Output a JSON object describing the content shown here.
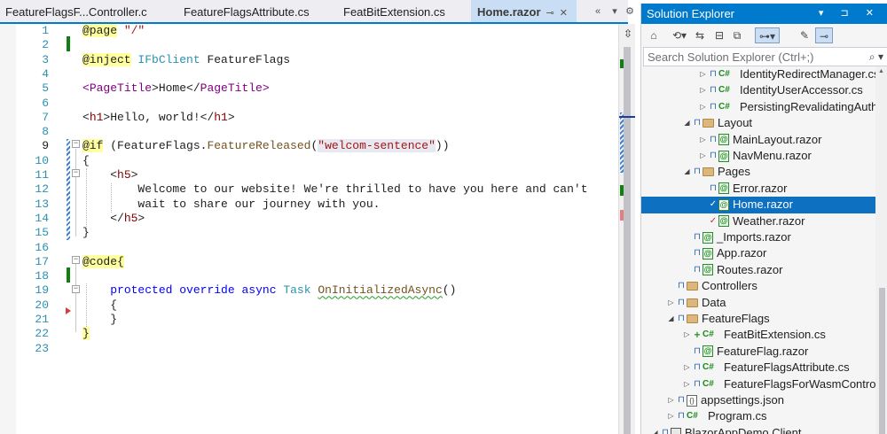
{
  "tabs": [
    {
      "title": "FeatureFlagsF...Controller.cs",
      "active": false
    },
    {
      "title": "FeatureFlagsAttribute.cs",
      "active": false
    },
    {
      "title": "FeatBitExtension.cs",
      "active": false
    },
    {
      "title": "Home.razor",
      "active": true
    }
  ],
  "tab_controls": {
    "pin_icon": "pin-icon",
    "close_icon": "close-icon",
    "scroll_left": "«",
    "dropdown": "▾",
    "settings": "⚙"
  },
  "editor": {
    "split_icon": "split-icon",
    "lines": [
      {
        "n": "1"
      },
      {
        "n": "2"
      },
      {
        "n": "3"
      },
      {
        "n": "4"
      },
      {
        "n": "5"
      },
      {
        "n": "6"
      },
      {
        "n": "7"
      },
      {
        "n": "8"
      },
      {
        "n": "9"
      },
      {
        "n": "10"
      },
      {
        "n": "11"
      },
      {
        "n": "12"
      },
      {
        "n": "13"
      },
      {
        "n": "14"
      },
      {
        "n": "15"
      },
      {
        "n": "16"
      },
      {
        "n": "17"
      },
      {
        "n": "18"
      },
      {
        "n": "19"
      },
      {
        "n": "20"
      },
      {
        "n": "21"
      },
      {
        "n": "22"
      },
      {
        "n": "23"
      }
    ],
    "code": {
      "l1_a": "@page",
      "l1_b": " ",
      "l1_c": "\"/\"",
      "l3_a": "@inject",
      "l3_b": " ",
      "l3_c": "IFbClient",
      "l3_d": " FeatureFlags",
      "l5_a": "<",
      "l5_b": "PageTitle",
      "l5_c": ">Home</",
      "l5_d": "PageTitle",
      "l5_e": ">",
      "l7_a": "<",
      "l7_b": "h1",
      "l7_c": ">Hello, world!</",
      "l7_d": "h1",
      "l7_e": ">",
      "l9_a": "@if",
      "l9_b": " (FeatureFlags.",
      "l9_c": "FeatureReleased",
      "l9_d": "(",
      "l9_e": "\"welcom-sentence\"",
      "l9_f": "))",
      "l10": "{",
      "l11_a": "    <",
      "l11_b": "h5",
      "l11_c": ">",
      "l12": "        Welcome to our website! We're thrilled to have you here and can't",
      "l13": "        wait to share our journey with you.",
      "l14_a": "    </",
      "l14_b": "h5",
      "l14_c": ">",
      "l15": "}",
      "l17_a": "@code",
      "l17_b": "{",
      "l19_a": "    ",
      "l19_b": "protected",
      "l19_c": " ",
      "l19_d": "override",
      "l19_e": " ",
      "l19_f": "async",
      "l19_g": " ",
      "l19_h": "Task",
      "l19_i": " ",
      "l19_j": "OnInitializedAsync",
      "l19_k": "()",
      "l20": "    {",
      "l21": "    }",
      "l22": "}"
    }
  },
  "solution_explorer": {
    "title": "Solution Explorer",
    "title_buttons": "▾ ⊐ ✕",
    "search_placeholder": "Search Solution Explorer (Ctrl+;)",
    "search_icon": "search-icon",
    "nodes": [
      {
        "label": "IdentityRedirectManager.cs",
        "kind": "cs",
        "expander": "▷",
        "status": "lock",
        "depth": 4
      },
      {
        "label": "IdentityUserAccessor.cs",
        "kind": "cs",
        "expander": "▷",
        "status": "lock",
        "depth": 4
      },
      {
        "label": "PersistingRevalidatingAuther",
        "kind": "cs",
        "expander": "▷",
        "status": "lock",
        "depth": 4
      },
      {
        "label": "Layout",
        "kind": "folder",
        "expander": "◢",
        "status": "lock",
        "depth": 3
      },
      {
        "label": "MainLayout.razor",
        "kind": "razor",
        "expander": "▷",
        "status": "lock",
        "depth": 4
      },
      {
        "label": "NavMenu.razor",
        "kind": "razor",
        "expander": "▷",
        "status": "lock",
        "depth": 4
      },
      {
        "label": "Pages",
        "kind": "folder",
        "expander": "◢",
        "status": "lock",
        "depth": 3
      },
      {
        "label": "Error.razor",
        "kind": "razor",
        "expander": "",
        "status": "lock",
        "depth": 4
      },
      {
        "label": "Home.razor",
        "kind": "razor",
        "expander": "",
        "status": "check",
        "depth": 4,
        "selected": true
      },
      {
        "label": "Weather.razor",
        "kind": "razor",
        "expander": "",
        "status": "check",
        "depth": 4
      },
      {
        "label": "_Imports.razor",
        "kind": "razor",
        "expander": "",
        "status": "lock",
        "depth": 3
      },
      {
        "label": "App.razor",
        "kind": "razor",
        "expander": "",
        "status": "lock",
        "depth": 3
      },
      {
        "label": "Routes.razor",
        "kind": "razor",
        "expander": "",
        "status": "lock",
        "depth": 3
      },
      {
        "label": "Controllers",
        "kind": "folder",
        "expander": "",
        "status": "lock",
        "depth": 2
      },
      {
        "label": "Data",
        "kind": "folder",
        "expander": "▷",
        "status": "lock",
        "depth": 2
      },
      {
        "label": "FeatureFlags",
        "kind": "folder",
        "expander": "◢",
        "status": "lock",
        "depth": 2
      },
      {
        "label": "FeatBitExtension.cs",
        "kind": "cs",
        "expander": "▷",
        "status": "add",
        "depth": 3
      },
      {
        "label": "FeatureFlag.razor",
        "kind": "razor",
        "expander": "",
        "status": "lock",
        "depth": 3
      },
      {
        "label": "FeatureFlagsAttribute.cs",
        "kind": "cs",
        "expander": "▷",
        "status": "lock",
        "depth": 3
      },
      {
        "label": "FeatureFlagsForWasmController",
        "kind": "cs",
        "expander": "▷",
        "status": "lock",
        "depth": 3
      },
      {
        "label": "appsettings.json",
        "kind": "json",
        "expander": "▷",
        "status": "lock",
        "depth": 2
      },
      {
        "label": "Program.cs",
        "kind": "cs",
        "expander": "▷",
        "status": "lock",
        "depth": 2
      },
      {
        "label": "BlazorAppDemo.Client",
        "kind": "proj",
        "expander": "◢",
        "status": "lock",
        "depth": 1
      }
    ],
    "toolbar_icons": [
      "home-icon",
      "sync-icon",
      "pending-changes-icon",
      "collapse-all-icon",
      "show-all-files-icon",
      "switch-views-icon",
      "properties-icon",
      "preview-icon"
    ],
    "colors": {
      "title_bg": "#007acc",
      "selected_bg": "#0e70c0",
      "lock": "#1f5fb3",
      "add": "#2a9d2a"
    }
  }
}
